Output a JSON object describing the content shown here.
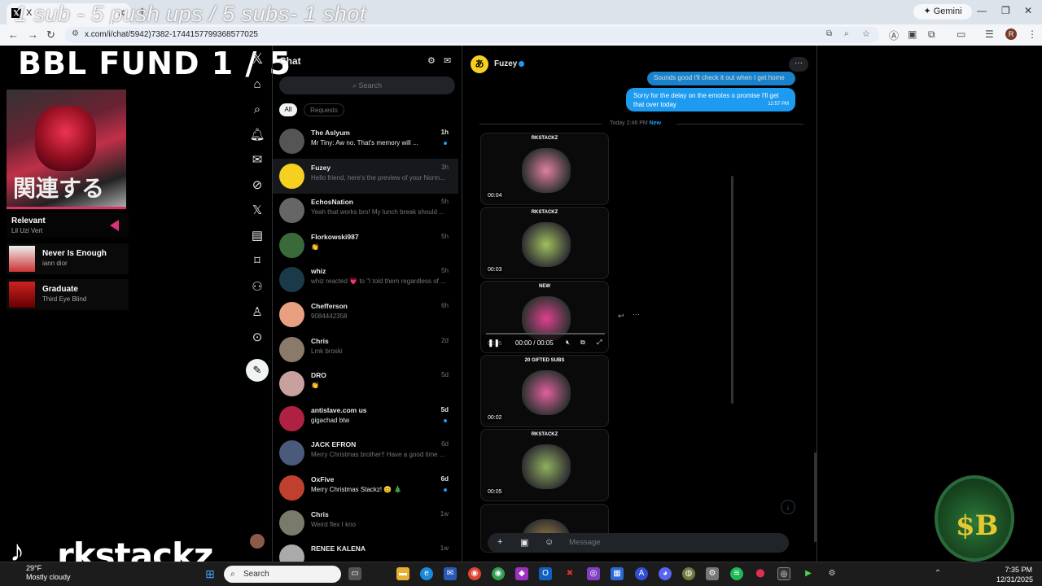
{
  "browser": {
    "tab_title": "X",
    "overlay_text": "1 sub - 5 push ups / 5 subs- 1 shot",
    "gemini_label": "Gemini",
    "url": "x.com/i/chat/5942)7382-1744157799368577025"
  },
  "stream": {
    "fund_text": "BBL FUND   1 / 5",
    "now_playing": {
      "title": "Relevant",
      "artist": "Lil Uzi Vert"
    },
    "queue": [
      {
        "title": "Never Is Enough",
        "artist": "iann dior"
      },
      {
        "title": "Graduate",
        "artist": "Third Eye Blind"
      }
    ],
    "brand": "rkstackz",
    "logo_text": "$B"
  },
  "chat": {
    "header": "Chat",
    "search_placeholder": "Search",
    "filters": [
      "All",
      "Requests"
    ],
    "conversations": [
      {
        "name": "The Aslyum",
        "preview": "Mr Tiny: Aw no. That's memory will ...",
        "time": "1h",
        "unread": true,
        "color": "#555"
      },
      {
        "name": "Fuzey",
        "preview": "Hello friend, here's the preview of your Norm...",
        "time": "3h",
        "unread": false,
        "color": "#f5d020",
        "selected": true
      },
      {
        "name": "EchosNation",
        "preview": "Yeah that works bro! My lunch break should ...",
        "time": "5h",
        "unread": false,
        "color": "#666"
      },
      {
        "name": "Florkowski987",
        "preview": "👏",
        "time": "5h",
        "unread": false,
        "color": "#3a6a3a"
      },
      {
        "name": "whiz",
        "preview": "whiz reacted 💗 to \"I told them regardless of ...",
        "time": "5h",
        "unread": false,
        "color": "#1a3a4a"
      },
      {
        "name": "Chefferson",
        "preview": "9084442358",
        "time": "6h",
        "unread": false,
        "color": "#e8a080"
      },
      {
        "name": "Chris",
        "preview": "Lmk broski",
        "time": "2d",
        "unread": false,
        "color": "#8a7a6a"
      },
      {
        "name": "DRO",
        "preview": "👏",
        "time": "5d",
        "unread": false,
        "color": "#c9a0a0"
      },
      {
        "name": "antislave.com us",
        "preview": "gigachad btw",
        "time": "5d",
        "unread": true,
        "color": "#b02040"
      },
      {
        "name": "JACK EFRON",
        "preview": "Merry Christmas brother!! Have a good time ...",
        "time": "6d",
        "unread": false,
        "color": "#4a5a7a"
      },
      {
        "name": "OxFive",
        "preview": "Merry Christmas Stackz! 😊 🎄",
        "time": "6d",
        "unread": true,
        "color": "#c04030"
      },
      {
        "name": "Chris",
        "preview": "Weird flex I kno",
        "time": "1w",
        "unread": false,
        "color": "#7a7a6a"
      },
      {
        "name": "RENEE KALENA",
        "preview": "",
        "time": "1w",
        "unread": false,
        "color": "#aaa"
      }
    ]
  },
  "conversation": {
    "contact": "Fuzey",
    "messages": [
      {
        "text": "Sounds good I'll check it out when I get home"
      },
      {
        "text": "Sorry for the delay on the emotes o promise I'll get that over today",
        "time": "12:57 PM"
      }
    ],
    "date_separator": "Today  2:46 PM",
    "new_label": "New",
    "videos": [
      {
        "duration": "00:04",
        "label": "RKSTACKZ",
        "color": "#e080a0"
      },
      {
        "duration": "00:03",
        "label": "RKSTACKZ",
        "color": "#a0c060"
      },
      {
        "duration": "00:05",
        "label": "NEW",
        "color": "#e04090",
        "playing": true,
        "time_readout": "00:00 / 00:05"
      },
      {
        "duration": "00:02",
        "label": "20 GIFTED SUBS",
        "color": "#e060a0"
      },
      {
        "duration": "00:05",
        "label": "RKSTACKZ",
        "color": "#90b060"
      },
      {
        "duration": "",
        "label": "",
        "color": "#a08040"
      }
    ],
    "composer_placeholder": "Message"
  },
  "taskbar": {
    "weather_temp": "29°F",
    "weather_desc": "Mostly cloudy",
    "search_label": "Search",
    "time": "7:35 PM",
    "date": "12/31/2025"
  }
}
